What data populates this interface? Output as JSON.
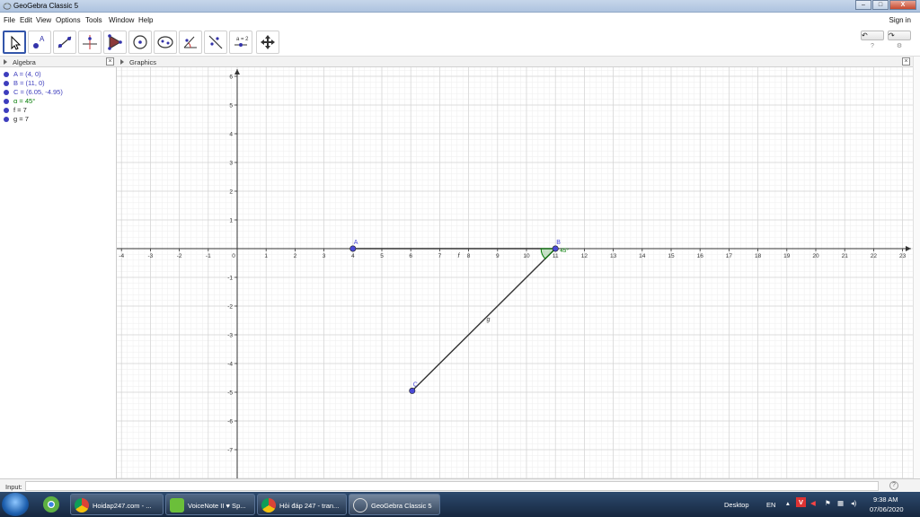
{
  "window": {
    "title": "GeoGebra Classic 5",
    "min": "–",
    "max": "□",
    "close": "X"
  },
  "menu": {
    "items": [
      "File",
      "Edit",
      "View",
      "Options",
      "Tools",
      "Window",
      "Help"
    ],
    "sign_in": "Sign in"
  },
  "toolbar": {
    "tools": [
      "move-tool",
      "point-tool",
      "line-tool",
      "perpendicular-line-tool",
      "polygon-tool",
      "circle-tool",
      "ellipse-tool",
      "angle-tool",
      "reflect-tool",
      "slider-tool",
      "move-graphics-tool"
    ],
    "undo_label": "↶",
    "redo_label": "↷",
    "help_glyph": "?",
    "settings_glyph": "⚙"
  },
  "algebra": {
    "header": "Algebra",
    "items": [
      {
        "text": "A = (4, 0)",
        "color": "#3d3dbd"
      },
      {
        "text": "B = (11, 0)",
        "color": "#3d3dbd"
      },
      {
        "text": "C = (6.05, -4.95)",
        "color": "#3d3dbd"
      },
      {
        "text": "α = 45°",
        "color": "#007a00"
      },
      {
        "text": "f = 7",
        "color": "#222222"
      },
      {
        "text": "g = 7",
        "color": "#222222"
      }
    ]
  },
  "graphics": {
    "header": "Graphics",
    "x_ticks": [
      -4,
      -3,
      -2,
      -1,
      0,
      1,
      2,
      3,
      4,
      5,
      6,
      7,
      8,
      9,
      10,
      11,
      12,
      13,
      14,
      15,
      16,
      17,
      18,
      19,
      20,
      21,
      22,
      23
    ],
    "y_ticks": [
      6,
      5,
      4,
      3,
      2,
      1,
      -1,
      -2,
      -3,
      -4,
      -5,
      -6,
      -7
    ],
    "points": [
      {
        "label": "A",
        "x": 4,
        "y": 0
      },
      {
        "label": "B",
        "x": 11,
        "y": 0
      },
      {
        "label": "C",
        "x": 6.05,
        "y": -4.95
      }
    ],
    "segments": [
      {
        "label": "f",
        "from": "A",
        "to": "B"
      },
      {
        "label": "g",
        "from": "B",
        "to": "C"
      }
    ],
    "angle": {
      "label": "α = 45°",
      "short": "45°",
      "vertex": "B"
    }
  },
  "input": {
    "label": "Input:",
    "help": "?"
  },
  "taskbar": {
    "tasks": [
      "Hoidap247.com - ...",
      "VoiceNote II ♥ Sp...",
      "Hỏi đáp 247 - tran...",
      "GeoGebra Classic 5"
    ],
    "desktop": "Desktop",
    "lang": "EN",
    "time": "9:38 AM",
    "date": "07/06/2020"
  },
  "colors": {
    "point": "#4a4ad6",
    "segment": "#333333",
    "angle": "#007a00",
    "grid_major": "#d3d3d3",
    "grid_minor": "#eeeeee"
  }
}
